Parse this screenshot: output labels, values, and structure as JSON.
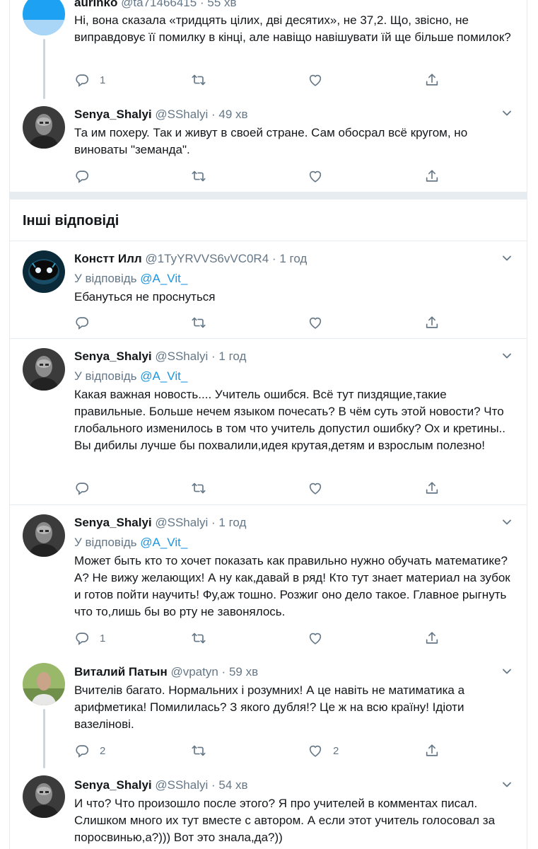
{
  "section_title": "Інші відповіді",
  "colors": {
    "accent": "#1b95e0",
    "muted": "#657786",
    "text": "#14171a",
    "border": "#e6ecf0"
  },
  "tweets": [
    {
      "name": "aurinko",
      "handle": "@ta71466415",
      "time": "55 хв",
      "reply_to_label": "",
      "reply_to": "",
      "text": "Ні, вона сказала «тридцять цілих, дві десятих», не 37,2. Що, звісно, не виправдовує її помилку в кінці, але навіщо навішувати їй ще більше помилок?",
      "replies": "1",
      "retweets": "",
      "likes": ""
    },
    {
      "name": "Senya_Shalyi",
      "handle": "@SShalyi",
      "time": "49 хв",
      "reply_to_label": "",
      "reply_to": "",
      "text": "Та им похеру. Так и живут в своей стране. Сам обосрал всё кругом, но виноваты \"земанда\".",
      "replies": "",
      "retweets": "",
      "likes": ""
    },
    {
      "name": "Констт Илл",
      "handle": "@1TyYRVVS6vVC0R4",
      "time": "1 год",
      "reply_to_label": "У відповідь",
      "reply_to": "@A_Vit_",
      "text": "Ебануться не проснуться",
      "replies": "",
      "retweets": "",
      "likes": ""
    },
    {
      "name": "Senya_Shalyi",
      "handle": "@SShalyi",
      "time": "1 год",
      "reply_to_label": "У відповідь",
      "reply_to": "@A_Vit_",
      "text": "Какая важная новость.... Учитель ошибся. Всё тут пиздящие,такие правильные. Больше нечем языком почесать? В чём суть этой новости? Что глобального изменилось в том что учитель допустил ошибку? Ох и кретины..  Вы дибилы лучше бы похвалили,идея крутая,детям и взрослым полезно!",
      "replies": "",
      "retweets": "",
      "likes": ""
    },
    {
      "name": "Senya_Shalyi",
      "handle": "@SShalyi",
      "time": "1 год",
      "reply_to_label": "У відповідь",
      "reply_to": "@A_Vit_",
      "text": "Может быть кто то хочет показать как правильно нужно обучать математике? А? Не вижу желающих! А ну как,давай в ряд! Кто тут знает материал на зубок и готов пойти научить! Фу,аж тошно. Розжиг оно дело такое. Главное рыгнуть что то,лишь бы во рту не завонялось.",
      "replies": "1",
      "retweets": "",
      "likes": ""
    },
    {
      "name": "Виталий Патын",
      "handle": "@vpatyn",
      "time": "59 хв",
      "reply_to_label": "",
      "reply_to": "",
      "text": "Вчителів багато. Нормальних і розумних! А це навіть не матиматика а арифметика! Помилилась? З якого дубля!? Це ж на всю країну! Ідіоти вазелінові.",
      "replies": "2",
      "retweets": "",
      "likes": "2"
    },
    {
      "name": "Senya_Shalyi",
      "handle": "@SShalyi",
      "time": "54 хв",
      "reply_to_label": "",
      "reply_to": "",
      "text": "И что? Что произошло после этого? Я про учителей в комментах писал. Слишком много их тут вместе с автором. А если этот учитель голосовал за поросвинью,а?))) Вот это знала,да?))",
      "replies": "",
      "retweets": "",
      "likes": ""
    }
  ]
}
